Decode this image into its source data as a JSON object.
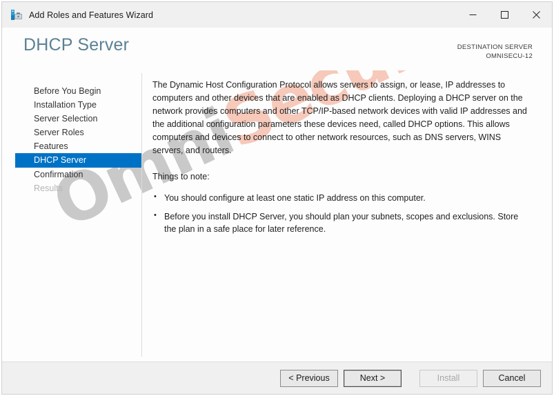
{
  "window": {
    "title": "Add Roles and Features Wizard",
    "icon": "server-manager-icon",
    "controls": {
      "minimize": "minimize-icon",
      "maximize": "maximize-icon",
      "close": "close-icon"
    }
  },
  "header": {
    "page_title": "DHCP Server",
    "destination_label": "DESTINATION SERVER",
    "destination_server": "OMNISECU-12"
  },
  "sidebar": {
    "items": [
      {
        "label": "Before You Begin",
        "state": "normal"
      },
      {
        "label": "Installation Type",
        "state": "normal"
      },
      {
        "label": "Server Selection",
        "state": "normal"
      },
      {
        "label": "Server Roles",
        "state": "normal"
      },
      {
        "label": "Features",
        "state": "normal"
      },
      {
        "label": "DHCP Server",
        "state": "selected"
      },
      {
        "label": "Confirmation",
        "state": "normal"
      },
      {
        "label": "Results",
        "state": "disabled"
      }
    ]
  },
  "content": {
    "intro": "The Dynamic Host Configuration Protocol allows servers to assign, or lease, IP addresses to computers and other devices that are enabled as DHCP clients. Deploying a DHCP server on the network provides computers and other TCP/IP-based network devices with valid IP addresses and the additional configuration parameters these devices need, called DHCP options. This allows computers and devices to connect to other network resources, such as DNS servers, WINS servers, and routers.",
    "notes_heading": "Things to note:",
    "notes": [
      "You should configure at least one static IP address on this computer.",
      "Before you install DHCP Server, you should plan your subnets, scopes and exclusions. Store the plan in a safe place for later reference."
    ]
  },
  "watermark": {
    "part1": "Omni",
    "part2": "Secu.com"
  },
  "footer": {
    "previous": "< Previous",
    "next": "Next >",
    "install": "Install",
    "cancel": "Cancel"
  },
  "colors": {
    "accent_selected": "#0072c6",
    "page_title": "#5b8193",
    "titlebar_bg": "#f0f0f0",
    "footer_bg": "#f0f0f0"
  }
}
